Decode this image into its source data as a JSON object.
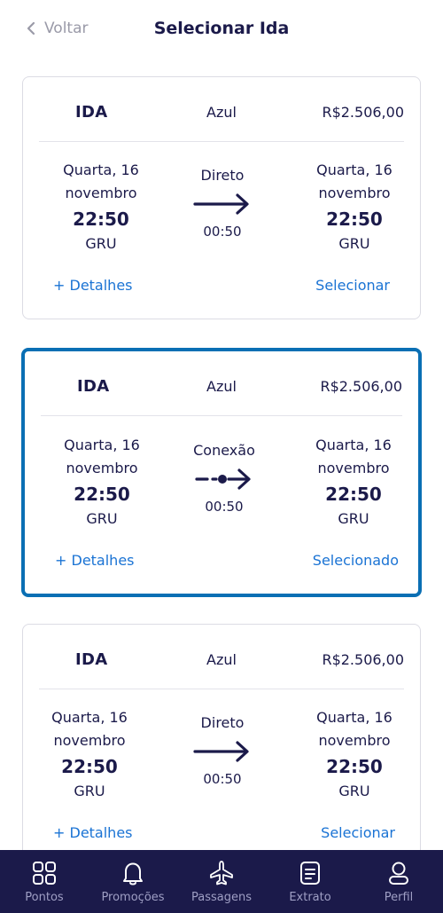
{
  "header": {
    "back_label": "Voltar",
    "title": "Selecionar Ida"
  },
  "flights": [
    {
      "tag": "IDA",
      "airline": "Azul",
      "price": "R$2.506,00",
      "dep": {
        "day": "Quarta, 16",
        "month": "novembro",
        "time": "22:50",
        "airport": "GRU"
      },
      "arr": {
        "day": "Quarta, 16",
        "month": "novembro",
        "time": "22:50",
        "airport": "GRU"
      },
      "type": "Direto",
      "duration": "00:50",
      "details_label": "+ Detalhes",
      "action_label": "Selecionar"
    },
    {
      "tag": "IDA",
      "airline": "Azul",
      "price": "R$2.506,00",
      "dep": {
        "day": "Quarta, 16",
        "month": "novembro",
        "time": "22:50",
        "airport": "GRU"
      },
      "arr": {
        "day": "Quarta, 16",
        "month": "novembro",
        "time": "22:50",
        "airport": "GRU"
      },
      "type": "Conexão",
      "duration": "00:50",
      "details_label": "+ Detalhes",
      "action_label": "Selecionado"
    },
    {
      "tag": "IDA",
      "airline": "Azul",
      "price": "R$2.506,00",
      "dep": {
        "day": "Quarta, 16",
        "month": "novembro",
        "time": "22:50",
        "airport": "GRU"
      },
      "arr": {
        "day": "Quarta, 16",
        "month": "novembro",
        "time": "22:50",
        "airport": "GRU"
      },
      "type": "Direto",
      "duration": "00:50",
      "details_label": "+ Detalhes",
      "action_label": "Selecionar"
    }
  ],
  "tabbar": {
    "items": [
      {
        "label": "Pontos",
        "icon": "grid-icon"
      },
      {
        "label": "Promoções",
        "icon": "bell-icon"
      },
      {
        "label": "Passagens",
        "icon": "airplane-icon"
      },
      {
        "label": "Extrato",
        "icon": "statement-icon"
      },
      {
        "label": "Perfil",
        "icon": "person-icon"
      }
    ]
  },
  "colors": {
    "primary": "#1b1a4a",
    "link": "#1a73d4",
    "selected_border": "#0a6fb4",
    "tab_text": "#9f9fc4"
  }
}
